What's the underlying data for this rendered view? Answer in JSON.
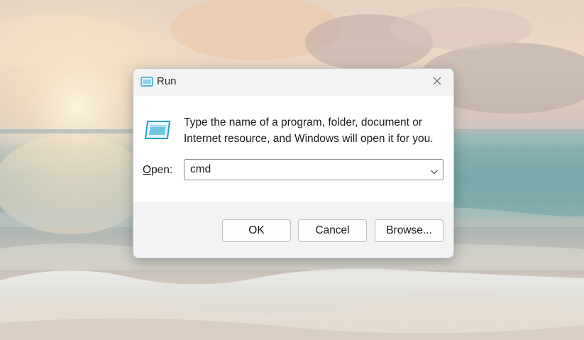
{
  "dialog": {
    "title": "Run",
    "description_line1": "Type the name of a program, folder, document or",
    "description_line2": "Internet resource, and Windows will open it for you.",
    "open_label_mnemonic": "O",
    "open_label_rest": "pen:",
    "open_value": "cmd",
    "buttons": {
      "ok": "OK",
      "cancel": "Cancel",
      "browse": "Browse..."
    }
  },
  "icons": {
    "title": "run-app-icon",
    "main": "run-app-icon",
    "close": "close-icon",
    "dropdown": "chevron-down-icon"
  },
  "colors": {
    "dialog_bg": "#f3f3f3",
    "content_bg": "#ffffff",
    "icon_accent": "#2aa0c8"
  }
}
